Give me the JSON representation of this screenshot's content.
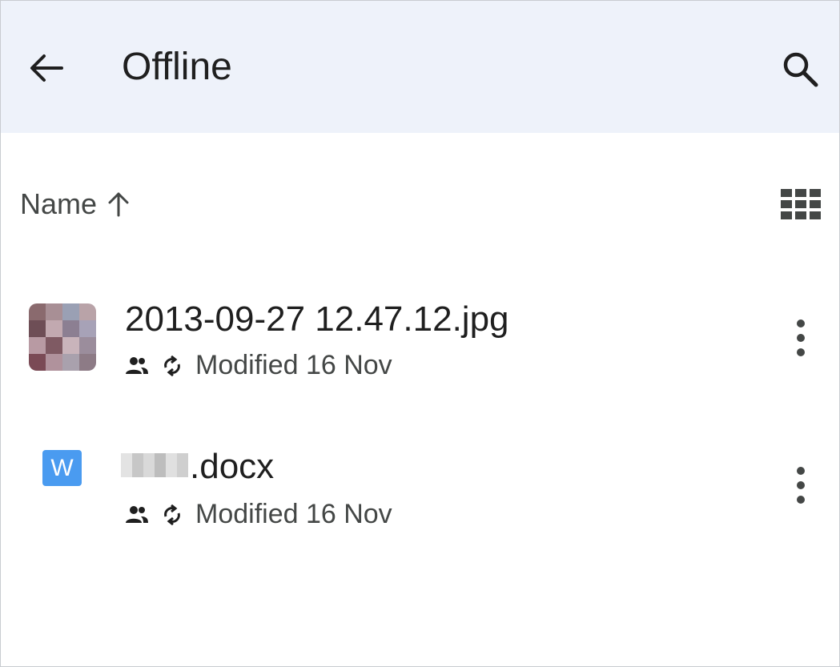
{
  "appbar": {
    "title": "Offline"
  },
  "sort": {
    "label": "Name",
    "direction": "ascending"
  },
  "files": [
    {
      "name": "2013-09-27 12.47.12.jpg",
      "type": "image",
      "modified": "Modified 16 Nov",
      "icons": [
        "shared-icon",
        "sync-icon"
      ]
    },
    {
      "name": ".docx",
      "type": "word",
      "type_badge": "W",
      "modified": "Modified 16 Nov",
      "icons": [
        "shared-icon",
        "sync-icon"
      ]
    }
  ],
  "colors": {
    "appbar_bg": "#eef2fa",
    "word_badge": "#4a9bf0",
    "text_primary": "#1f1f1f",
    "text_secondary": "#444746"
  }
}
